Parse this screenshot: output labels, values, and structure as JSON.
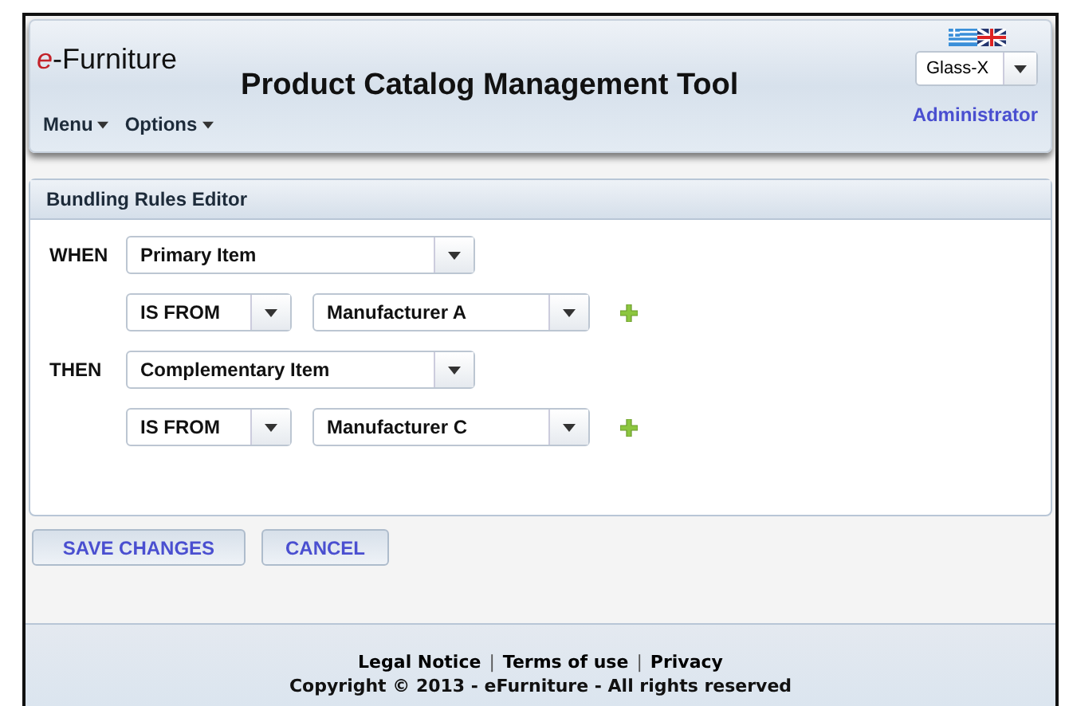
{
  "header": {
    "logo": "*e*-Furniture",
    "title": "Product Catalog Management Tool",
    "theme_select": {
      "value": "Glass-X"
    },
    "menus": [
      "Menu",
      "Options"
    ],
    "user": "Administrator"
  },
  "panel": {
    "title": "Bundling Rules Editor",
    "rules": [
      {
        "label": "WHEN",
        "item": "Primary Item",
        "operator": "IS FROM",
        "value": "Manufacturer A"
      },
      {
        "label": "THEN",
        "item": "Complementary Item",
        "operator": "IS FROM",
        "value": "Manufacturer C"
      }
    ]
  },
  "buttons": [
    "SAVE CHANGES",
    "CANCEL"
  ],
  "footer": {
    "links": [
      {
        "kind": "link",
        "text": "Legal Notice"
      },
      {
        "kind": "separator",
        "text": "|"
      },
      {
        "kind": "link",
        "text": "Terms of use"
      },
      {
        "kind": "separator",
        "text": "|"
      },
      {
        "kind": "link",
        "text": "Privacy"
      }
    ],
    "copyright": "Copyright © 2013 - eFurniture - All rights reserved"
  }
}
